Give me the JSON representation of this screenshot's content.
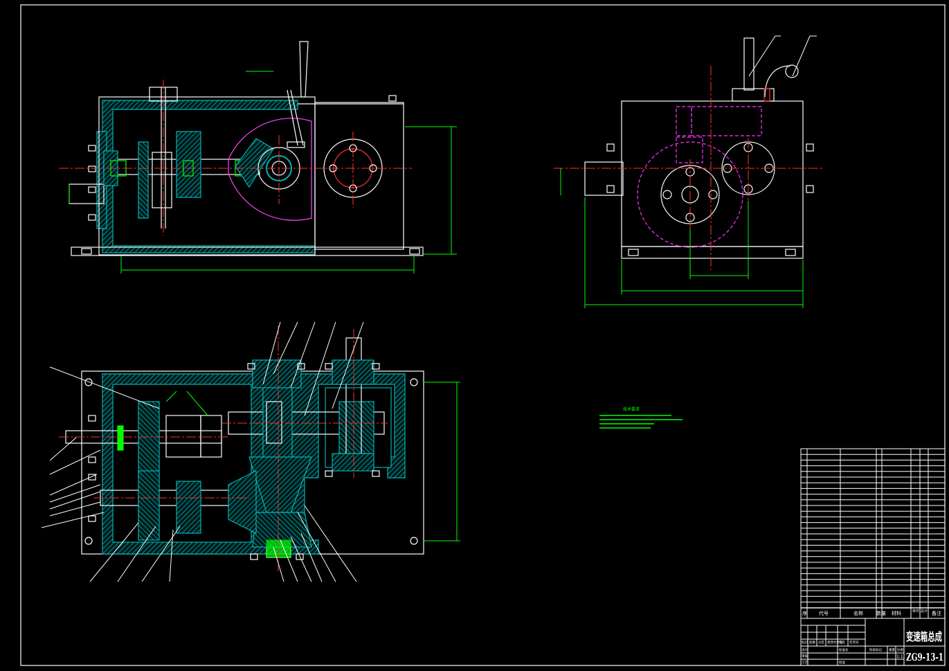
{
  "drawing": {
    "title_cn": "变速箱总成",
    "drawing_no": "ZG9-13-1",
    "scale": "1:1",
    "technical_requirements_heading": "技术要求"
  },
  "title_block": {
    "bom_header": [
      "序",
      "代号",
      "名称",
      "数量",
      "材料",
      "单件",
      "总计",
      "备注"
    ],
    "signature_labels": [
      "标记",
      "处数",
      "分区",
      "更改文件号",
      "签名",
      "年月日"
    ],
    "role_labels": [
      "设计",
      "审核",
      "工艺",
      "标准化",
      "批准"
    ],
    "stage_labels": [
      "阶段标记",
      "重量",
      "比例"
    ]
  },
  "colors": {
    "background": "#000000",
    "outline": "#ffffff",
    "section_fill": "#00b4b4",
    "center_line": "#ff3030",
    "dimension": "#00ff00",
    "hidden": "#ff33ff",
    "leader": "#ffffff"
  }
}
